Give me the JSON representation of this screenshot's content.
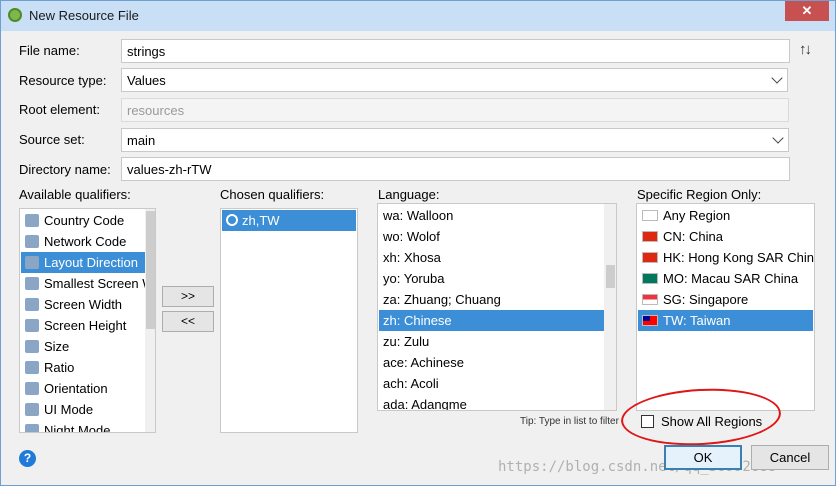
{
  "window": {
    "title": "New Resource File",
    "close_glyph": "✕"
  },
  "form": {
    "file_name": {
      "label": "File name:",
      "value": "strings"
    },
    "resource_type": {
      "label": "Resource type:",
      "value": "Values"
    },
    "root_element": {
      "label": "Root element:",
      "placeholder": "resources"
    },
    "source_set": {
      "label": "Source set:",
      "value": "main"
    },
    "directory_name": {
      "label": "Directory name:",
      "value": "values-zh-rTW"
    },
    "sort_icon": "↑↓"
  },
  "available": {
    "header": "Available qualifiers:",
    "items": [
      {
        "label": "Country Code",
        "icon": "country-code-icon",
        "selected": false
      },
      {
        "label": "Network Code",
        "icon": "network-code-icon",
        "selected": false
      },
      {
        "label": "Layout Direction",
        "icon": "layout-direction-icon",
        "selected": true
      },
      {
        "label": "Smallest Screen W",
        "icon": "smallest-screen-icon",
        "selected": false
      },
      {
        "label": "Screen Width",
        "icon": "screen-width-icon",
        "selected": false
      },
      {
        "label": "Screen Height",
        "icon": "screen-height-icon",
        "selected": false
      },
      {
        "label": "Size",
        "icon": "size-icon",
        "selected": false
      },
      {
        "label": "Ratio",
        "icon": "ratio-icon",
        "selected": false
      },
      {
        "label": "Orientation",
        "icon": "orientation-icon",
        "selected": false
      },
      {
        "label": "UI Mode",
        "icon": "ui-mode-icon",
        "selected": false
      },
      {
        "label": "Night Mode",
        "icon": "night-mode-icon",
        "selected": false
      }
    ]
  },
  "move_buttons": {
    "add": ">>",
    "remove": "<<"
  },
  "chosen": {
    "header": "Chosen qualifiers:",
    "items": [
      {
        "label": "zh,TW",
        "icon": "globe-icon",
        "selected": true
      }
    ]
  },
  "language": {
    "header": "Language:",
    "items": [
      {
        "label": "wa: Walloon",
        "selected": false
      },
      {
        "label": "wo: Wolof",
        "selected": false
      },
      {
        "label": "xh: Xhosa",
        "selected": false
      },
      {
        "label": "yo: Yoruba",
        "selected": false
      },
      {
        "label": "za: Zhuang; Chuang",
        "selected": false
      },
      {
        "label": "zh: Chinese",
        "selected": true
      },
      {
        "label": "zu: Zulu",
        "selected": false
      },
      {
        "label": "ace: Achinese",
        "selected": false
      },
      {
        "label": "ach: Acoli",
        "selected": false
      },
      {
        "label": "ada: Adangme",
        "selected": false
      }
    ]
  },
  "region": {
    "header": "Specific Region Only:",
    "items": [
      {
        "label": "Any Region",
        "flag": "blank-flag-icon",
        "selected": false
      },
      {
        "label": "CN: China",
        "flag": "china-flag-icon",
        "selected": false
      },
      {
        "label": "HK: Hong Kong SAR China",
        "flag": "hong-kong-flag-icon",
        "selected": false
      },
      {
        "label": "MO: Macau SAR China",
        "flag": "macau-flag-icon",
        "selected": false
      },
      {
        "label": "SG: Singapore",
        "flag": "singapore-flag-icon",
        "selected": false
      },
      {
        "label": "TW: Taiwan",
        "flag": "taiwan-flag-icon",
        "selected": true
      }
    ]
  },
  "hint": "Tip: Type in list to filter",
  "show_all_regions": {
    "label": "Show All Regions",
    "checked": false
  },
  "footer": {
    "help": "?",
    "ok": "OK",
    "cancel": "Cancel"
  },
  "watermark": "https://blog.csdn.net/qq_36992688",
  "colors": {
    "selection": "#3c8fd6",
    "annotation": "#e01515"
  }
}
